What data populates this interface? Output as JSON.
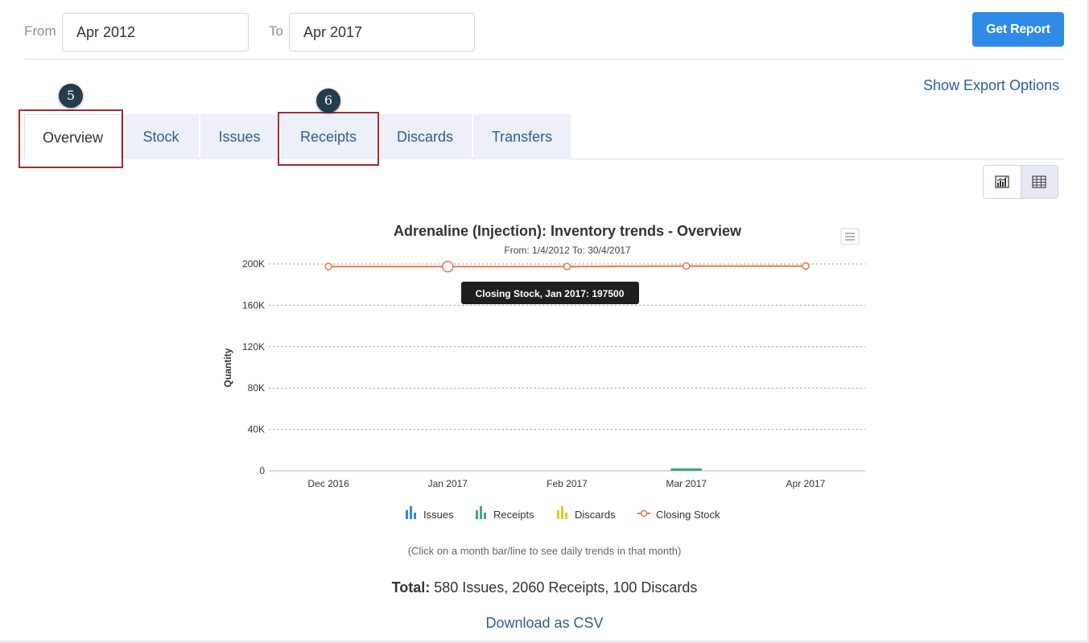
{
  "filters": {
    "from_label": "From",
    "from_value": "Apr 2012",
    "to_label": "To",
    "to_value": "Apr 2017",
    "get_report": "Get Report"
  },
  "export_link": "Show Export Options",
  "tabs": [
    {
      "label": "Overview",
      "active": true
    },
    {
      "label": "Stock"
    },
    {
      "label": "Issues"
    },
    {
      "label": "Receipts"
    },
    {
      "label": "Discards"
    },
    {
      "label": "Transfers"
    }
  ],
  "annotations": {
    "badge_5": "5",
    "badge_6": "6"
  },
  "view_toggle": {
    "chart_icon": "chart-icon",
    "table_icon": "table-icon",
    "selected": "chart"
  },
  "chart_data": {
    "type": "line",
    "title": "Adrenaline (Injection): Inventory trends - Overview",
    "subtitle": "From: 1/4/2012 To: 30/4/2017",
    "ylabel": "Quantity",
    "xlabel": "",
    "categories": [
      "Dec 2016",
      "Jan 2017",
      "Feb 2017",
      "Mar 2017",
      "Apr 2017"
    ],
    "ylim": [
      0,
      200000
    ],
    "yticks": [
      0,
      40000,
      80000,
      120000,
      160000,
      200000
    ],
    "ytick_labels": [
      "0",
      "40K",
      "80K",
      "120K",
      "160K",
      "200K"
    ],
    "grid": true,
    "series": [
      {
        "name": "Issues",
        "type": "bar",
        "color": "#2e8ae6",
        "values": [
          0,
          0,
          0,
          0,
          0
        ]
      },
      {
        "name": "Receipts",
        "type": "bar",
        "color": "#3aa987",
        "values": [
          0,
          0,
          0,
          2060,
          0
        ]
      },
      {
        "name": "Discards",
        "type": "bar",
        "color": "#f2c12e",
        "values": [
          0,
          0,
          0,
          0,
          0
        ]
      },
      {
        "name": "Closing Stock",
        "type": "line",
        "color": "#e8764a",
        "values": [
          197500,
          197500,
          197500,
          198000,
          198000
        ]
      }
    ],
    "legend_position": "bottom",
    "tooltip": "Closing Stock, Jan 2017: 197500"
  },
  "hint": "(Click on a month bar/line to see daily trends in that month)",
  "total": {
    "label": "Total:",
    "text": " 580 Issues, 2060 Receipts, 100 Discards"
  },
  "download": "Download as CSV"
}
